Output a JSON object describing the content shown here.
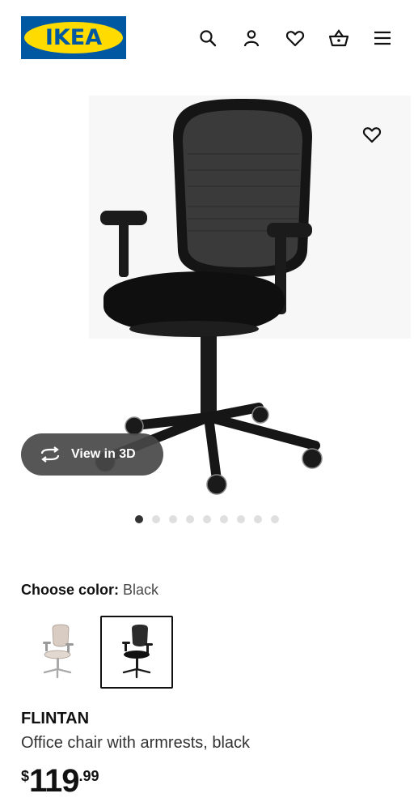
{
  "header": {
    "logo_text": "IKEA",
    "brand_colors": {
      "blue": "#0058a3",
      "yellow": "#ffdb00"
    },
    "icons": [
      "search-icon",
      "account-icon",
      "heart-icon",
      "basket-icon",
      "menu-icon"
    ]
  },
  "media": {
    "view_3d_label": "View in 3D",
    "favorite_icon": "heart-icon",
    "carousel": {
      "count": 9,
      "active": 0
    }
  },
  "color": {
    "label": "Choose color:",
    "value": "Black",
    "options": [
      {
        "name": "beige",
        "selected": false
      },
      {
        "name": "black",
        "selected": true
      }
    ]
  },
  "product": {
    "name": "FLINTAN",
    "description": "Office chair with armrests, black",
    "price": {
      "currency": "$",
      "integer": "119",
      "decimal": ".99"
    }
  }
}
